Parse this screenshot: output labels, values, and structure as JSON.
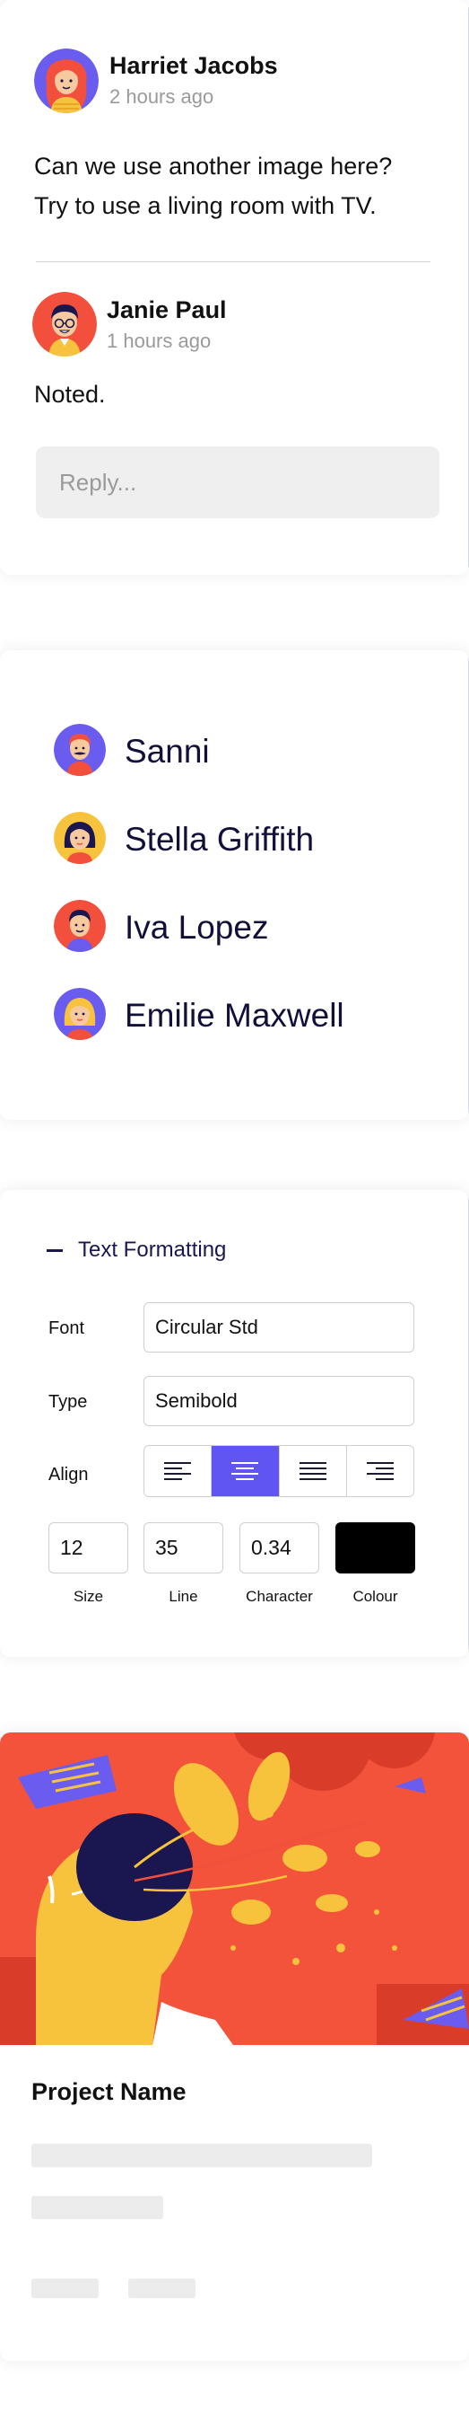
{
  "comments": [
    {
      "author": "Harriet Jacobs",
      "time": "2 hours ago",
      "lines": [
        "Can we use another image here?",
        "Try to use a living room with TV."
      ]
    },
    {
      "author": "Janie Paul",
      "time": "1 hours ago",
      "lines": [
        "Noted."
      ]
    }
  ],
  "reply": {
    "placeholder": "Reply..."
  },
  "people": [
    {
      "name": "Sanni",
      "avatar_icon": "man-mustache-avatar"
    },
    {
      "name": "Stella Griffith",
      "avatar_icon": "woman-avatar"
    },
    {
      "name": "Iva Lopez",
      "avatar_icon": "man-avatar"
    },
    {
      "name": "Emilie Maxwell",
      "avatar_icon": "blonde-woman-avatar"
    }
  ],
  "text_formatting": {
    "title": "Text Formatting",
    "font_label": "Font",
    "font_value": "Circular Std",
    "type_label": "Type",
    "type_value": "Semibold",
    "align_label": "Align",
    "align_options": [
      "left",
      "center",
      "justify",
      "right"
    ],
    "align_selected": "center",
    "size_value": "12",
    "size_label": "Size",
    "line_value": "35",
    "line_label": "Line",
    "character_value": "0.34",
    "character_label": "Character",
    "colour_label": "Colour",
    "colour_value": "#000000"
  },
  "project": {
    "name": "Project Name"
  },
  "colors": {
    "accent": "#6055f2",
    "hero_red": "#f2533a",
    "navy": "#1a1750"
  }
}
